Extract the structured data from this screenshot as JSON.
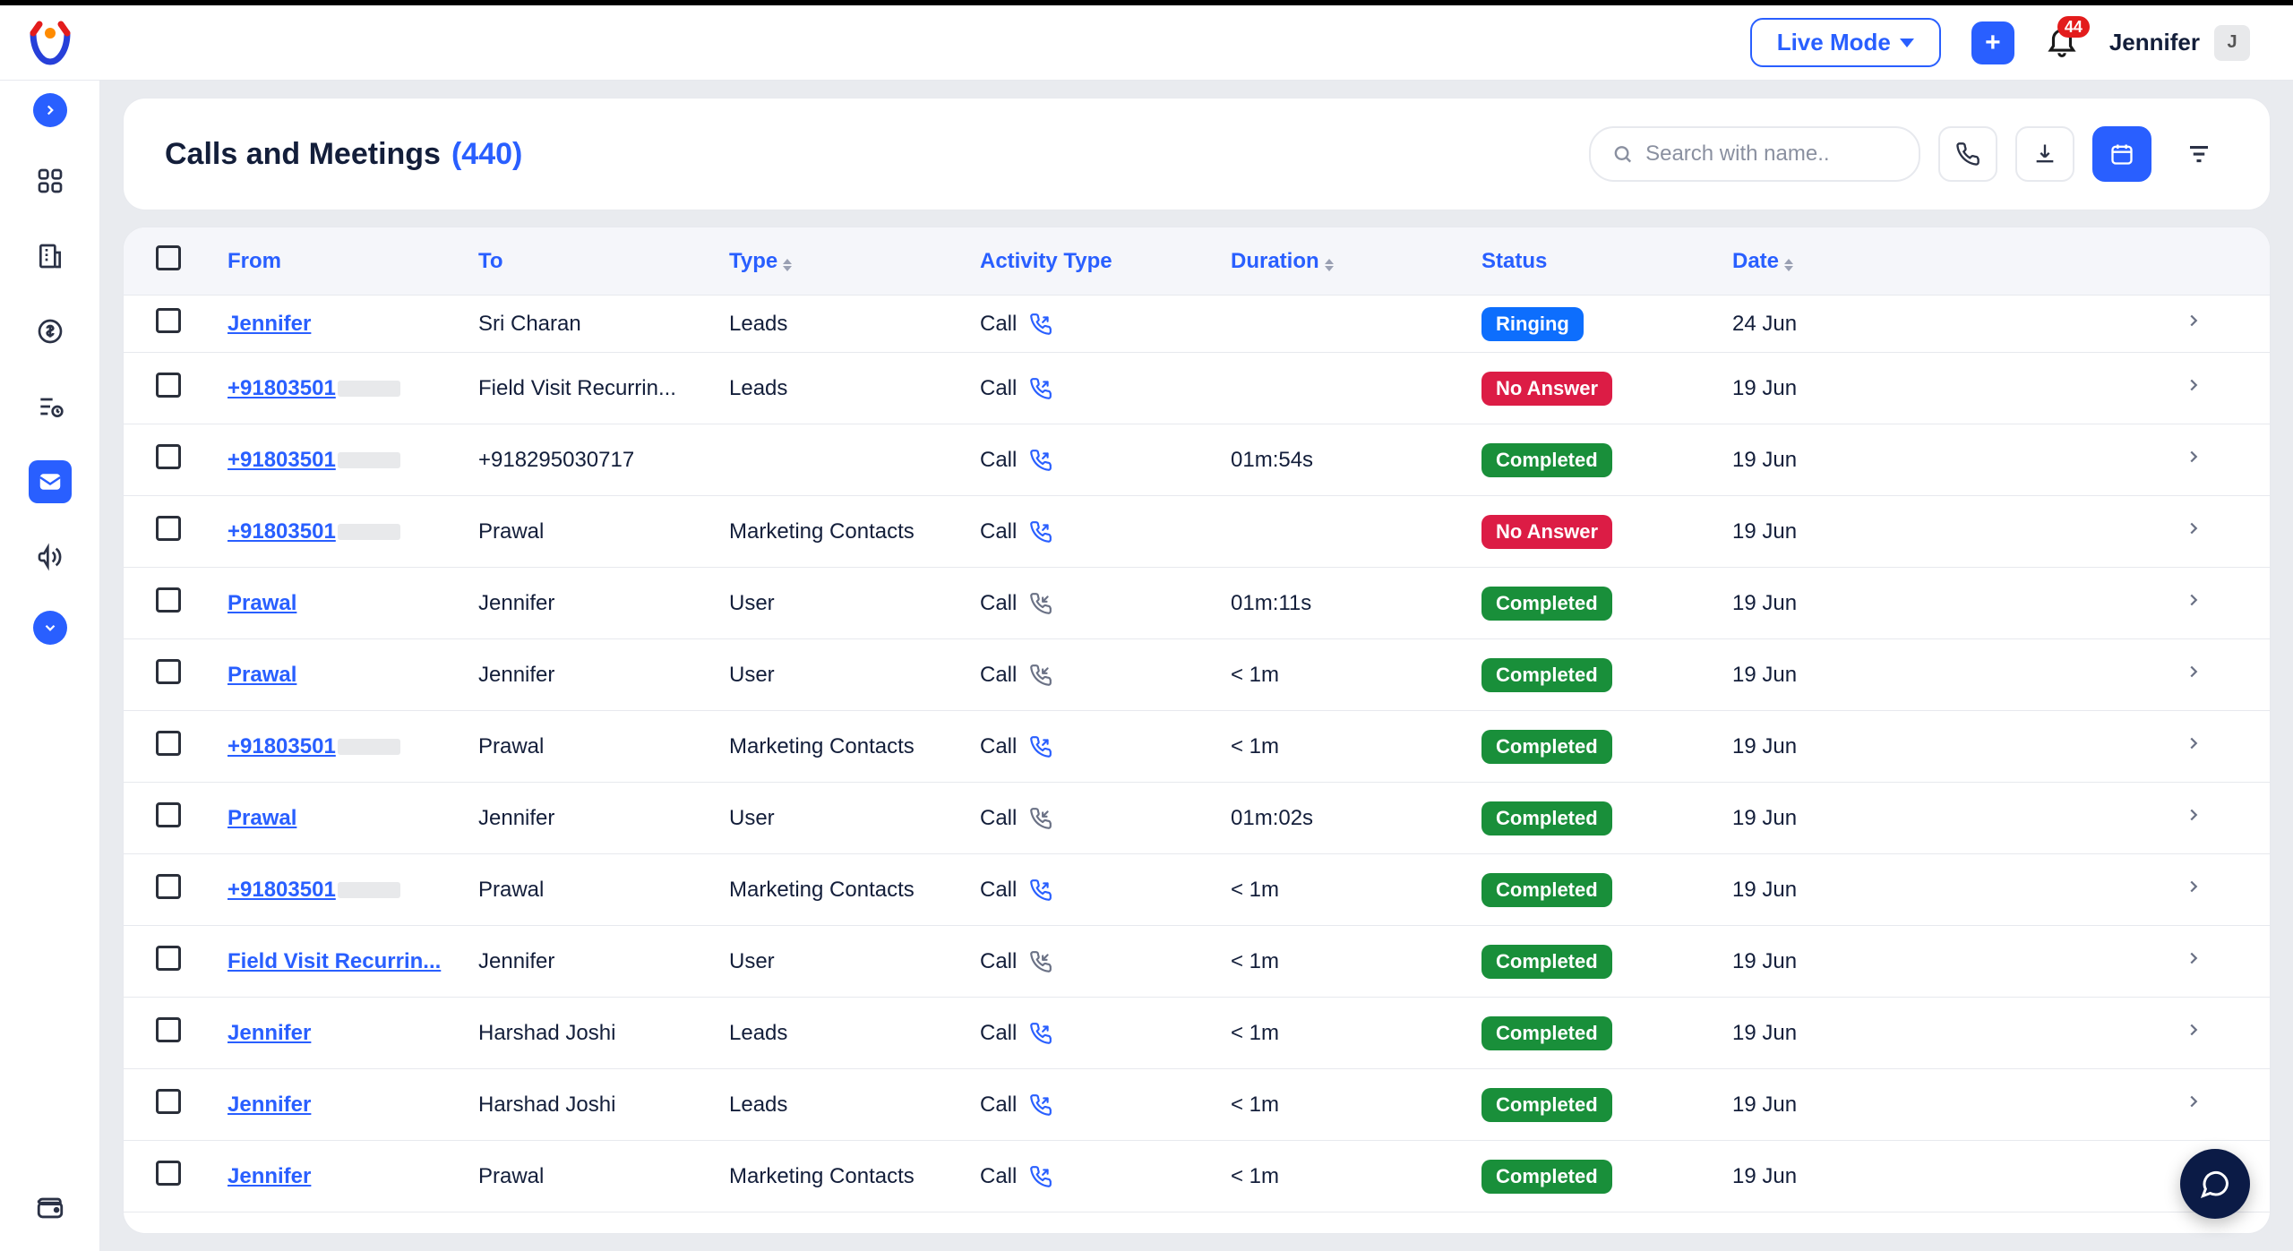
{
  "header": {
    "live_mode_label": "Live Mode",
    "notification_count": "44",
    "user_name": "Jennifer",
    "user_initial": "J"
  },
  "page": {
    "title": "Calls and Meetings",
    "count_display": "(440)",
    "search_placeholder": "Search with name.."
  },
  "columns": {
    "from": "From",
    "to": "To",
    "type": "Type",
    "activity_type": "Activity Type",
    "duration": "Duration",
    "status": "Status",
    "date": "Date"
  },
  "status_labels": {
    "ringing": "Ringing",
    "no_answer": "No Answer",
    "completed": "Completed"
  },
  "rows": [
    {
      "from": "Jennifer",
      "from_obscured": false,
      "to": "Sri Charan",
      "type": "Leads",
      "activity": "Call",
      "direction": "out",
      "duration": "",
      "status": "ringing",
      "date": "24 Jun"
    },
    {
      "from": "+91803501",
      "from_obscured": true,
      "to": "Field Visit Recurrin...",
      "type": "Leads",
      "activity": "Call",
      "direction": "out",
      "duration": "",
      "status": "no_answer",
      "date": "19 Jun"
    },
    {
      "from": "+91803501",
      "from_obscured": true,
      "to": "+918295030717",
      "type": "",
      "activity": "Call",
      "direction": "out",
      "duration": "01m:54s",
      "status": "completed",
      "date": "19 Jun"
    },
    {
      "from": "+91803501",
      "from_obscured": true,
      "to": "Prawal",
      "type": "Marketing Contacts",
      "activity": "Call",
      "direction": "out",
      "duration": "",
      "status": "no_answer",
      "date": "19 Jun"
    },
    {
      "from": "Prawal",
      "from_obscured": false,
      "to": "Jennifer",
      "type": "User",
      "activity": "Call",
      "direction": "in",
      "duration": "01m:11s",
      "status": "completed",
      "date": "19 Jun"
    },
    {
      "from": "Prawal",
      "from_obscured": false,
      "to": "Jennifer",
      "type": "User",
      "activity": "Call",
      "direction": "in",
      "duration": "< 1m",
      "status": "completed",
      "date": "19 Jun"
    },
    {
      "from": "+91803501",
      "from_obscured": true,
      "to": "Prawal",
      "type": "Marketing Contacts",
      "activity": "Call",
      "direction": "out",
      "duration": "< 1m",
      "status": "completed",
      "date": "19 Jun"
    },
    {
      "from": "Prawal",
      "from_obscured": false,
      "to": "Jennifer",
      "type": "User",
      "activity": "Call",
      "direction": "in",
      "duration": "01m:02s",
      "status": "completed",
      "date": "19 Jun"
    },
    {
      "from": "+91803501",
      "from_obscured": true,
      "to": "Prawal",
      "type": "Marketing Contacts",
      "activity": "Call",
      "direction": "out",
      "duration": "< 1m",
      "status": "completed",
      "date": "19 Jun"
    },
    {
      "from": "Field Visit Recurrin...",
      "from_obscured": false,
      "to": "Jennifer",
      "type": "User",
      "activity": "Call",
      "direction": "in",
      "duration": "< 1m",
      "status": "completed",
      "date": "19 Jun"
    },
    {
      "from": "Jennifer",
      "from_obscured": false,
      "to": "Harshad Joshi",
      "type": "Leads",
      "activity": "Call",
      "direction": "out",
      "duration": "< 1m",
      "status": "completed",
      "date": "19 Jun"
    },
    {
      "from": "Jennifer",
      "from_obscured": false,
      "to": "Harshad Joshi",
      "type": "Leads",
      "activity": "Call",
      "direction": "out",
      "duration": "< 1m",
      "status": "completed",
      "date": "19 Jun"
    },
    {
      "from": "Jennifer",
      "from_obscured": false,
      "to": "Prawal",
      "type": "Marketing Contacts",
      "activity": "Call",
      "direction": "out",
      "duration": "< 1m",
      "status": "completed",
      "date": "19 Jun"
    }
  ]
}
